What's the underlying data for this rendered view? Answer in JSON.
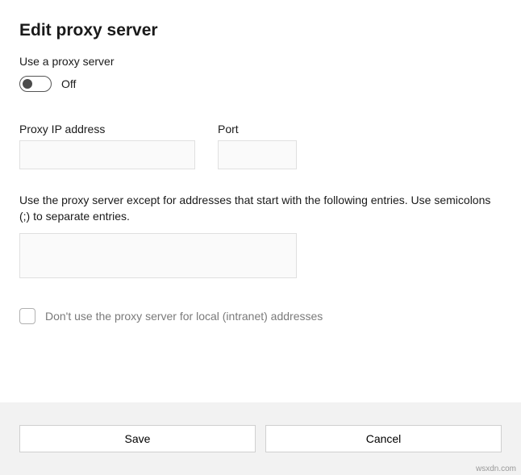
{
  "title": "Edit proxy server",
  "useProxyLabel": "Use a proxy server",
  "toggle": {
    "state": "Off"
  },
  "fields": {
    "ip": {
      "label": "Proxy IP address",
      "value": ""
    },
    "port": {
      "label": "Port",
      "value": ""
    }
  },
  "exceptions": {
    "description": "Use the proxy server except for addresses that start with the following entries. Use semicolons (;) to separate entries.",
    "value": ""
  },
  "bypassLocal": {
    "label": "Don't use the proxy server for local (intranet) addresses",
    "checked": false
  },
  "buttons": {
    "save": "Save",
    "cancel": "Cancel"
  },
  "watermark": "wsxdn.com"
}
